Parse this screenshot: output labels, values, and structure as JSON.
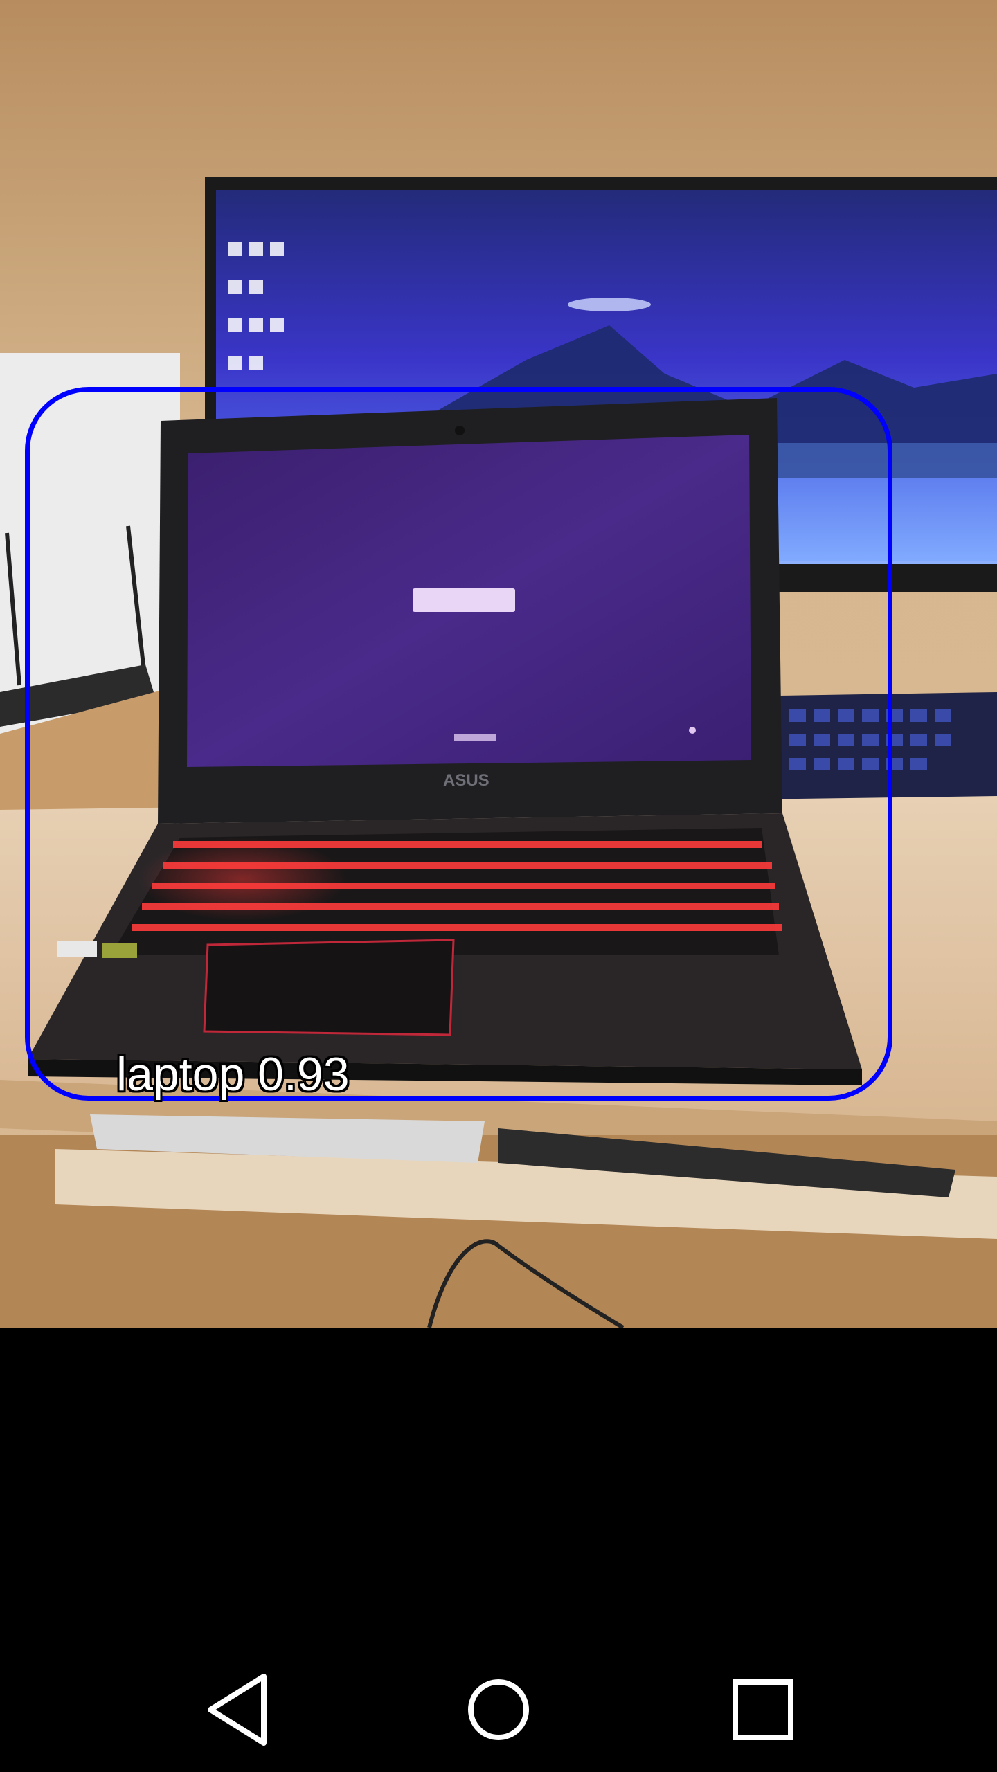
{
  "detection": {
    "label": "laptop 0.93",
    "box_color": "#0000ff"
  },
  "laptop_brand_text": "ASUS",
  "nav_bar": {
    "buttons": [
      {
        "name": "back",
        "icon": "triangle-back-icon"
      },
      {
        "name": "home",
        "icon": "circle-home-icon"
      },
      {
        "name": "recents",
        "icon": "square-recents-icon"
      }
    ],
    "icon_color": "#ffffff"
  }
}
